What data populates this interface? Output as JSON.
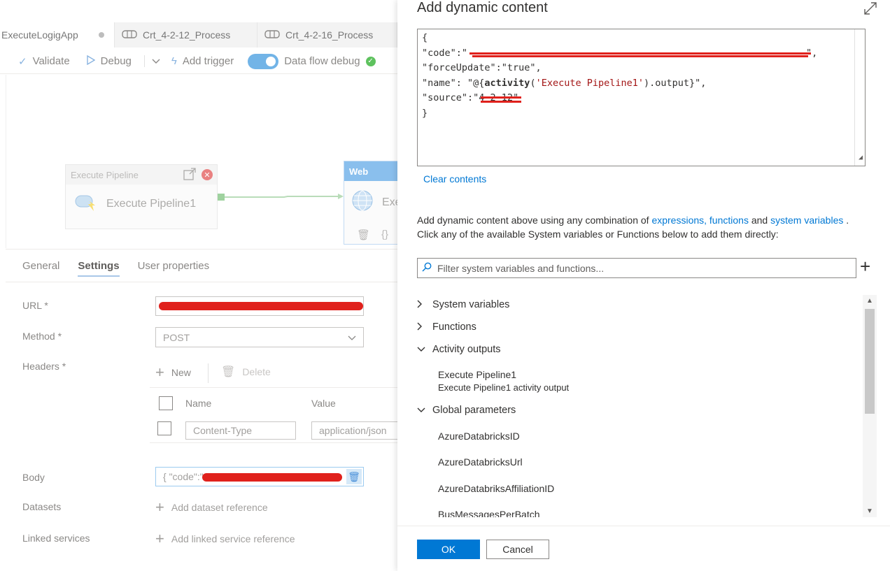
{
  "editor_tabs": [
    {
      "label": "ExecuteLogigApp"
    },
    {
      "label": "Crt_4-2-12_Process"
    },
    {
      "label": "Crt_4-2-16_Process"
    }
  ],
  "toolbar": {
    "validate": "Validate",
    "debug": "Debug",
    "add_trigger": "Add trigger",
    "data_flow_debug": "Data flow debug"
  },
  "canvas": {
    "activity1_type": "Execute Pipeline",
    "activity1_name": "Execute Pipeline1",
    "activity2_type": "Web",
    "activity2_name_partial": "Exe"
  },
  "properties": {
    "tabs": [
      "General",
      "Settings",
      "User properties"
    ],
    "url_label": "URL *",
    "method_label": "Method *",
    "method_value": "POST",
    "headers_label": "Headers *",
    "new_label": "New",
    "delete_label": "Delete",
    "col_name": "Name",
    "col_value": "Value",
    "header_name_value": "Content-Type",
    "header_value_value": "application/json",
    "body_label": "Body",
    "body_value": "{ \"code\":\"",
    "datasets_label": "Datasets",
    "add_dataset": "Add dataset reference",
    "linked_label": "Linked services",
    "add_linked": "Add linked service reference"
  },
  "panel": {
    "title": "Add dynamic content",
    "code": {
      "open": "{",
      "code_key": "\"code\":\"",
      "code_end": "\",",
      "force_line": "\"forceUpdate\":\"true\",",
      "name_key": "\"name\": \"@{",
      "name_fn": "activity",
      "name_arg": "'Execute Pipeline1'",
      "name_rest": ").output}\",",
      "source_key": "\"source\":\"",
      "source_val": "4-2-12",
      "source_end": "\"",
      "close": "}"
    },
    "clear_contents": "Clear contents",
    "desc_prefix": "Add dynamic content above using any combination of ",
    "desc_link1": "expressions, functions",
    "desc_and": " and ",
    "desc_link2": "system variables",
    "desc_suffix": " .",
    "desc_line2": "Click any of the available System variables or Functions below to add them directly:",
    "filter_placeholder": "Filter system variables and functions...",
    "groups": {
      "system_variables": "System variables",
      "functions": "Functions",
      "activity_outputs": "Activity outputs",
      "global_parameters": "Global parameters"
    },
    "activity_item": "Execute Pipeline1",
    "activity_item_sub": "Execute Pipeline1 activity output",
    "global_items": [
      "AzureDatabricksID",
      "AzureDatabricksUrl",
      "AzureDatabriksAffiliationID",
      "BusMessagesPerBatch"
    ],
    "ok": "OK",
    "cancel": "Cancel"
  }
}
